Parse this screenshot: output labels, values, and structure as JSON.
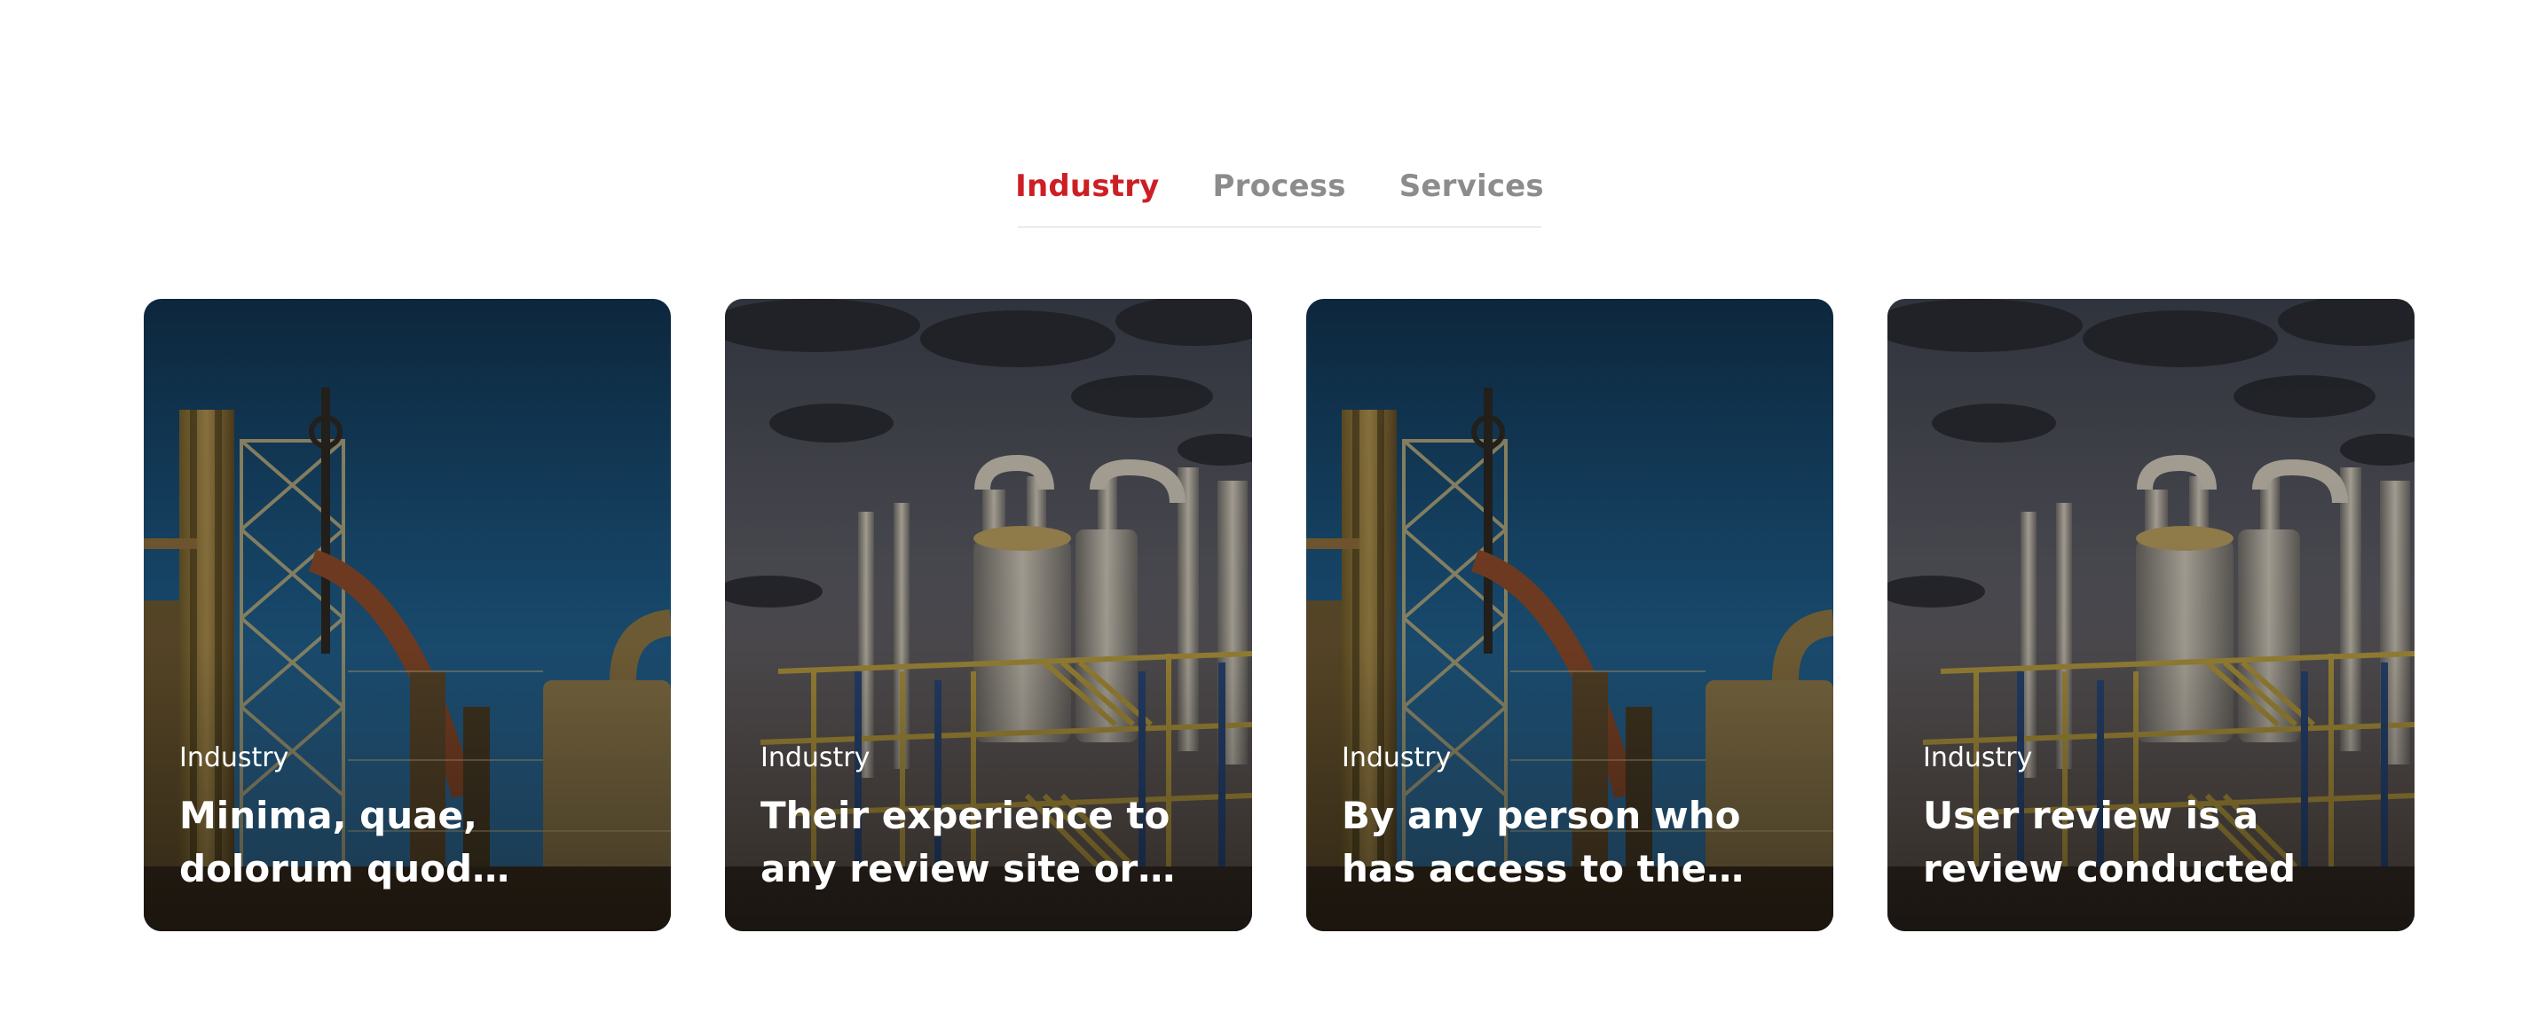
{
  "tabs": [
    {
      "label": "Industry",
      "active": true
    },
    {
      "label": "Process",
      "active": false
    },
    {
      "label": "Services",
      "active": false
    }
  ],
  "colors": {
    "accent": "#cc1f25",
    "tab_inactive": "#8c8c8c"
  },
  "cards": [
    {
      "category": "Industry",
      "title": "Minima, quae, dolorum quod molestiae labore quibusdam",
      "image": "steel-mill-blue-sky"
    },
    {
      "category": "Industry",
      "title": "Their experience to any review site or social",
      "image": "refinery-cloudy-sky"
    },
    {
      "category": "Industry",
      "title": "By any person who has access to the internet",
      "image": "steel-mill-blue-sky"
    },
    {
      "category": "Industry",
      "title": "User review is a review conducted",
      "image": "refinery-cloudy-sky"
    }
  ]
}
